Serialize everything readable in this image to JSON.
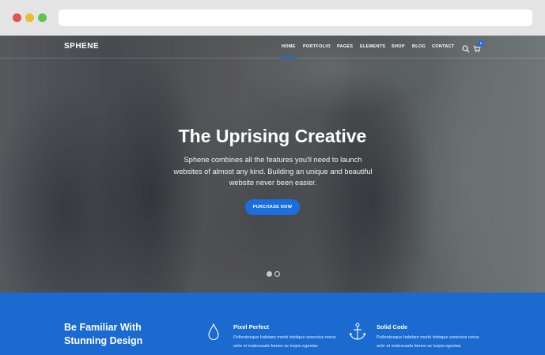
{
  "browser": {
    "colors": {
      "close": "#e0544f",
      "minimize": "#e8bd2e",
      "maximize": "#5fc34e"
    }
  },
  "nav": {
    "logo": "SPHENE",
    "items": [
      {
        "label": "HOME",
        "active": true
      },
      {
        "label": "PORTFOLIO"
      },
      {
        "label": "PAGES"
      },
      {
        "label": "ELEMENTS"
      },
      {
        "label": "SHOP"
      },
      {
        "label": "BLOG"
      },
      {
        "label": "CONTACT"
      }
    ],
    "search_icon": "search-icon",
    "cart_icon": "cart-icon",
    "cart_count": "1"
  },
  "hero": {
    "title": "The Uprising Creative",
    "text": "Sphene combines all the features you'll need to launch websites of almost any kind. Building an unique and beautiful website never been easier.",
    "cta": "PURCHASE NOW",
    "slides_total": 2,
    "active_slide": 1
  },
  "features": {
    "heading": "Be Familiar With Stunning Design",
    "items": [
      {
        "icon": "drop-icon",
        "title": "Pixel Perfect",
        "text": "Pellentesque habitant morbi tristique senectus netus ante et malesuada fames ac turpis egestas"
      },
      {
        "icon": "anchor-icon",
        "title": "Solid Code",
        "text": "Pellentesque habitant morbi tristique senectus netus ante et malesuada fames ac turpis egestas"
      }
    ]
  },
  "colors": {
    "accent": "#1a6fe0",
    "band": "#1a6ad0"
  }
}
